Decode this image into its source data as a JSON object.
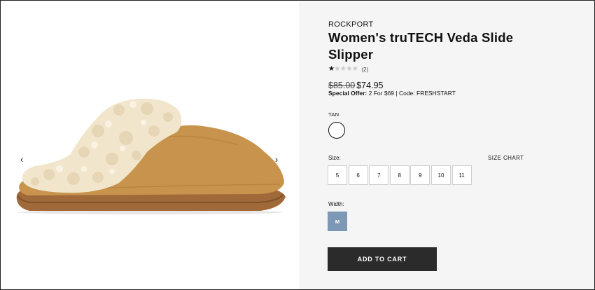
{
  "gallery": {
    "prev_arrow": "‹",
    "next_arrow": "›"
  },
  "product": {
    "brand": "ROCKPORT",
    "title": "Women's truTECH Veda Slide Slipper",
    "rating": {
      "value": 1,
      "max": 5,
      "review_count": "(2)"
    },
    "price_original": "$85.00",
    "price_sale": "$74.95",
    "offer_label": "Special Offer:",
    "offer_text": " 2 For $69 | Code: FRESHSTART",
    "color_name": "TAN",
    "size_label": "Size:",
    "size_chart": "SIZE CHART",
    "sizes": [
      "5",
      "6",
      "7",
      "8",
      "9",
      "10",
      "11"
    ],
    "width_label": "Width:",
    "width_selected": "M",
    "add_to_cart": "ADD TO CART"
  },
  "colors": {
    "info_panel_bg": "#f5f5f5",
    "width_selected_bg": "#7c98b6",
    "button_bg": "#2b2b2b",
    "suede": "#c8944d",
    "shearling": "#f1e5cc"
  }
}
